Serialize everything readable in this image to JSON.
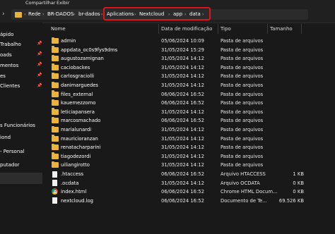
{
  "ribbon": {
    "tabs": [
      "Compartilhar",
      "Exibir"
    ]
  },
  "address": {
    "crumbs": [
      "Rede",
      "BR-DADOS",
      "br-dados",
      "Aplications",
      "Nextcloud",
      "app",
      "data"
    ]
  },
  "sidebar": {
    "items": [
      "ápido",
      "Trabalho",
      "oads",
      "mentos",
      "es",
      "Clientes",
      "s Funcionários",
      "iond",
      "- Personal",
      "putador"
    ]
  },
  "columns": {
    "name": "Nome",
    "date": "Data de modificação",
    "type": "Tipo",
    "size": "Tamanho"
  },
  "files": [
    {
      "name": "admin",
      "date": "05/06/2024 10:09",
      "type": "Pasta de arquivos",
      "size": "",
      "icon": "folder"
    },
    {
      "name": "appdata_oc0s9fys9dms",
      "date": "31/05/2024 15:29",
      "type": "Pasta de arquivos",
      "size": "",
      "icon": "folder"
    },
    {
      "name": "augustozamignan",
      "date": "31/05/2024 14:12",
      "type": "Pasta de arquivos",
      "size": "",
      "icon": "folder"
    },
    {
      "name": "caciobackes",
      "date": "31/05/2024 14:12",
      "type": "Pasta de arquivos",
      "size": "",
      "icon": "folder"
    },
    {
      "name": "carlosgraciolli",
      "date": "31/05/2024 14:12",
      "type": "Pasta de arquivos",
      "size": "",
      "icon": "folder"
    },
    {
      "name": "danimarguedes",
      "date": "31/05/2024 14:12",
      "type": "Pasta de arquivos",
      "size": "",
      "icon": "folder"
    },
    {
      "name": "files_external",
      "date": "06/06/2024 16:52",
      "type": "Pasta de arquivos",
      "size": "",
      "icon": "folder"
    },
    {
      "name": "kauemezzomo",
      "date": "06/06/2024 16:52",
      "type": "Pasta de arquivos",
      "size": "",
      "icon": "folder"
    },
    {
      "name": "leticiapansera",
      "date": "31/05/2024 14:12",
      "type": "Pasta de arquivos",
      "size": "",
      "icon": "folder"
    },
    {
      "name": "marcosmachado",
      "date": "06/06/2024 16:52",
      "type": "Pasta de arquivos",
      "size": "",
      "icon": "folder"
    },
    {
      "name": "marialunardi",
      "date": "31/05/2024 14:12",
      "type": "Pasta de arquivos",
      "size": "",
      "icon": "folder"
    },
    {
      "name": "mauricioranzan",
      "date": "31/05/2024 14:12",
      "type": "Pasta de arquivos",
      "size": "",
      "icon": "folder"
    },
    {
      "name": "renatacharparini",
      "date": "31/05/2024 14:12",
      "type": "Pasta de arquivos",
      "size": "",
      "icon": "folder"
    },
    {
      "name": "tiagodezordi",
      "date": "31/05/2024 14:12",
      "type": "Pasta de arquivos",
      "size": "",
      "icon": "folder"
    },
    {
      "name": "uiliangirotto",
      "date": "31/05/2024 14:12",
      "type": "Pasta de arquivos",
      "size": "",
      "icon": "folder"
    },
    {
      "name": ".htaccess",
      "date": "06/06/2024 16:52",
      "type": "Arquivo HTACCESS",
      "size": "1 KB",
      "icon": "file"
    },
    {
      "name": ".ocdata",
      "date": "31/05/2024 14:12",
      "type": "Arquivo OCDATA",
      "size": "0 KB",
      "icon": "file"
    },
    {
      "name": "index.html",
      "date": "06/06/2024 16:52",
      "type": "Chrome HTML Docum...",
      "size": "0 KB",
      "icon": "chrome"
    },
    {
      "name": "nextcloud.log",
      "date": "06/06/2024 16:52",
      "type": "Documento de Te...",
      "size": "69.526 KB",
      "icon": "file"
    }
  ]
}
